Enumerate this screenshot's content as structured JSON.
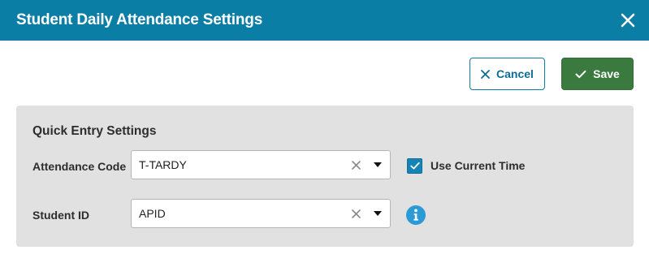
{
  "header": {
    "title": "Student Daily Attendance Settings",
    "close_icon": "close-icon",
    "background_color": "#0b7ea6"
  },
  "actions": {
    "cancel_label": "Cancel",
    "cancel_icon": "x-icon",
    "save_label": "Save",
    "save_icon": "check-icon",
    "save_color": "#3a7a3f"
  },
  "quick_entry": {
    "title": "Quick Entry Settings",
    "attendance_code": {
      "label": "Attendance Code",
      "value": "T-TARDY"
    },
    "use_current_time": {
      "label": "Use Current Time",
      "checked": true
    },
    "student_id": {
      "label": "Student ID",
      "value": "APID"
    },
    "info_icon": "info-icon"
  }
}
